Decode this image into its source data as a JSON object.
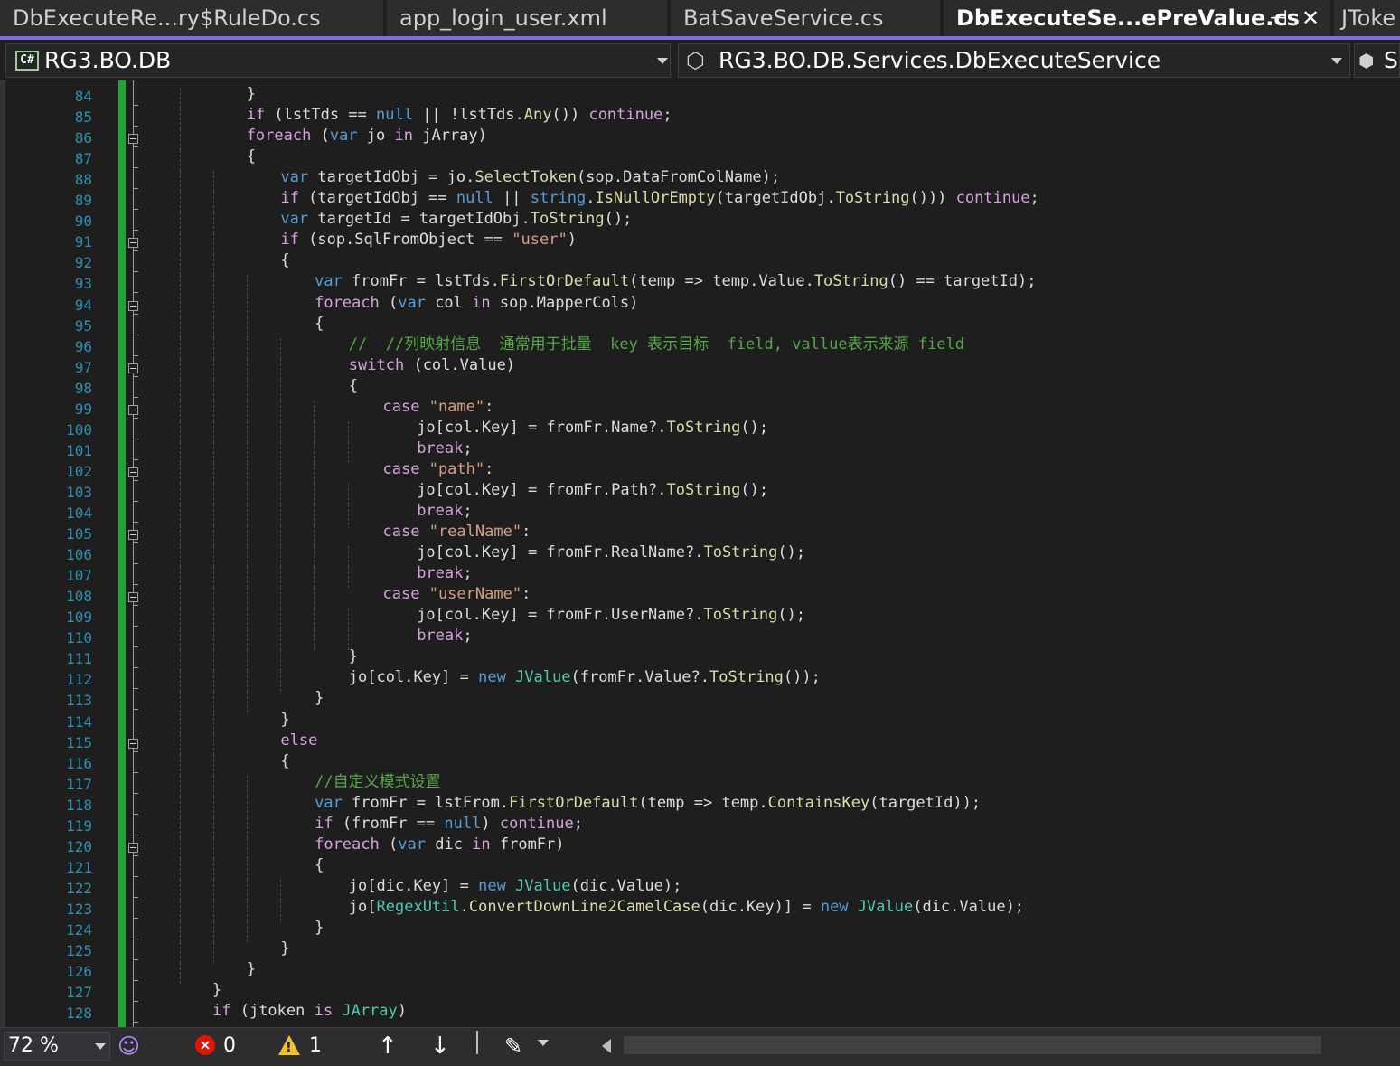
{
  "tabs": [
    {
      "label": "DbExecuteRe...ry$RuleDo.cs",
      "active": false
    },
    {
      "label": "app_login_user.xml",
      "active": false
    },
    {
      "label": "BatSaveService.cs",
      "active": false
    },
    {
      "label": "DbExecuteSe...ePreValue.cs",
      "active": true
    },
    {
      "label": "JToke",
      "active": false
    }
  ],
  "tab_icons": {
    "pin": "pin-icon",
    "close": "close-icon"
  },
  "navbar": {
    "project": "RG3.BO.DB",
    "project_icon": "C#",
    "type": "RG3.BO.DB.Services.DbExecuteService",
    "member": "S"
  },
  "code": {
    "line_numbers": [
      "84",
      "85",
      "86",
      "87",
      "88",
      "89",
      "90",
      "91",
      "92",
      "93",
      "94",
      "95",
      "96",
      "97",
      "98",
      "99",
      "100",
      "101",
      "102",
      "103",
      "104",
      "105",
      "106",
      "107",
      "108",
      "109",
      "110",
      "111",
      "112",
      "113",
      "114",
      "115",
      "116",
      "117",
      "118",
      "119",
      "120",
      "121",
      "122",
      "123",
      "124",
      "125",
      "126",
      "127",
      "128"
    ],
    "lines": [
      "}",
      "if (lstTds == null || !lstTds.Any()) continue;",
      "foreach (var jo in jArray)",
      "{",
      "var targetIdObj = jo.SelectToken(sop.DataFromColName);",
      "if (targetIdObj == null || string.IsNullOrEmpty(targetIdObj.ToString())) continue;",
      "var targetId = targetIdObj.ToString();",
      "if (sop.SqlFromObject == \"user\")",
      "{",
      "var fromFr = lstTds.FirstOrDefault(temp => temp.Value.ToString() == targetId);",
      "foreach (var col in sop.MapperCols)",
      "{",
      "//  //列映射信息  通常用于批量  key 表示目标  field, vallue表示来源 field",
      "switch (col.Value)",
      "{",
      "case \"name\":",
      "jo[col.Key] = fromFr.Name?.ToString();",
      "break;",
      "case \"path\":",
      "jo[col.Key] = fromFr.Path?.ToString();",
      "break;",
      "case \"realName\":",
      "jo[col.Key] = fromFr.RealName?.ToString();",
      "break;",
      "case \"userName\":",
      "jo[col.Key] = fromFr.UserName?.ToString();",
      "break;",
      "}",
      "jo[col.Key] = new JValue(fromFr.Value?.ToString());",
      "}",
      "}",
      "else",
      "{",
      "//自定义模式设置",
      "var fromFr = lstFrom.FirstOrDefault(temp => temp.ContainsKey(targetId));",
      "if (fromFr == null) continue;",
      "foreach (var dic in fromFr)",
      "{",
      "jo[dic.Key] = new JValue(dic.Value);",
      "jo[RegexUtil.ConvertDownLine2CamelCase(dic.Key)] = new JValue(dic.Value);",
      "}",
      "}",
      "}",
      "}",
      "if (jtoken is JArray)"
    ]
  },
  "statusbar": {
    "zoom": "72 %",
    "errors": "0",
    "warnings": "1",
    "icons": [
      "copilot-icon",
      "error-icon",
      "warning-icon",
      "arrow-up-icon",
      "arrow-down-icon",
      "brush-icon"
    ]
  },
  "colors": {
    "accent": "#7f6ee2",
    "changebar": "#1fa336",
    "keyword": "#569cd6",
    "control": "#d8a0df",
    "string": "#d69d85",
    "comment": "#57a64a",
    "type": "#4ec9b0",
    "method": "#dcdcaa",
    "line_number": "#2b91af"
  }
}
